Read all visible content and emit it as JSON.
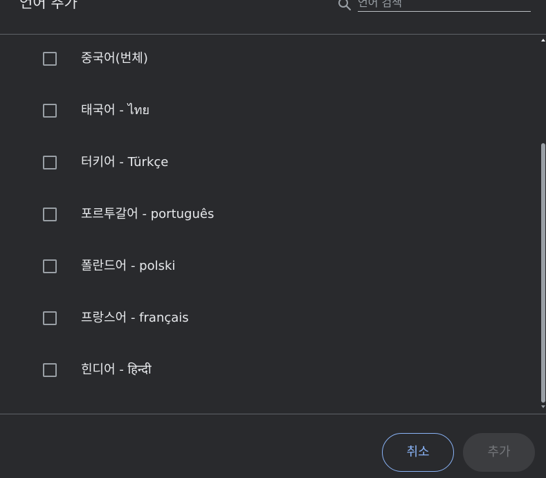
{
  "dialog": {
    "title": "언어 추가",
    "search": {
      "placeholder": "언어 검색",
      "value": ""
    }
  },
  "languages": [
    {
      "label": "중국어(번체)",
      "checked": false
    },
    {
      "label": "태국어 - ไทย",
      "checked": false
    },
    {
      "label": "터키어 - Türkçe",
      "checked": false
    },
    {
      "label": "포르투갈어 - português",
      "checked": false
    },
    {
      "label": "폴란드어 - polski",
      "checked": false
    },
    {
      "label": "프랑스어 - français",
      "checked": false
    },
    {
      "label": "힌디어 - हिन्दी",
      "checked": false
    }
  ],
  "footer": {
    "cancel_label": "취소",
    "add_label": "추가"
  },
  "colors": {
    "background": "#292a2d",
    "accent": "#8ab4f8",
    "divider": "#5f6368",
    "disabled_button_bg": "#3c3d40"
  },
  "icons": {
    "search": "search-icon",
    "checkbox": "checkbox-icon"
  }
}
